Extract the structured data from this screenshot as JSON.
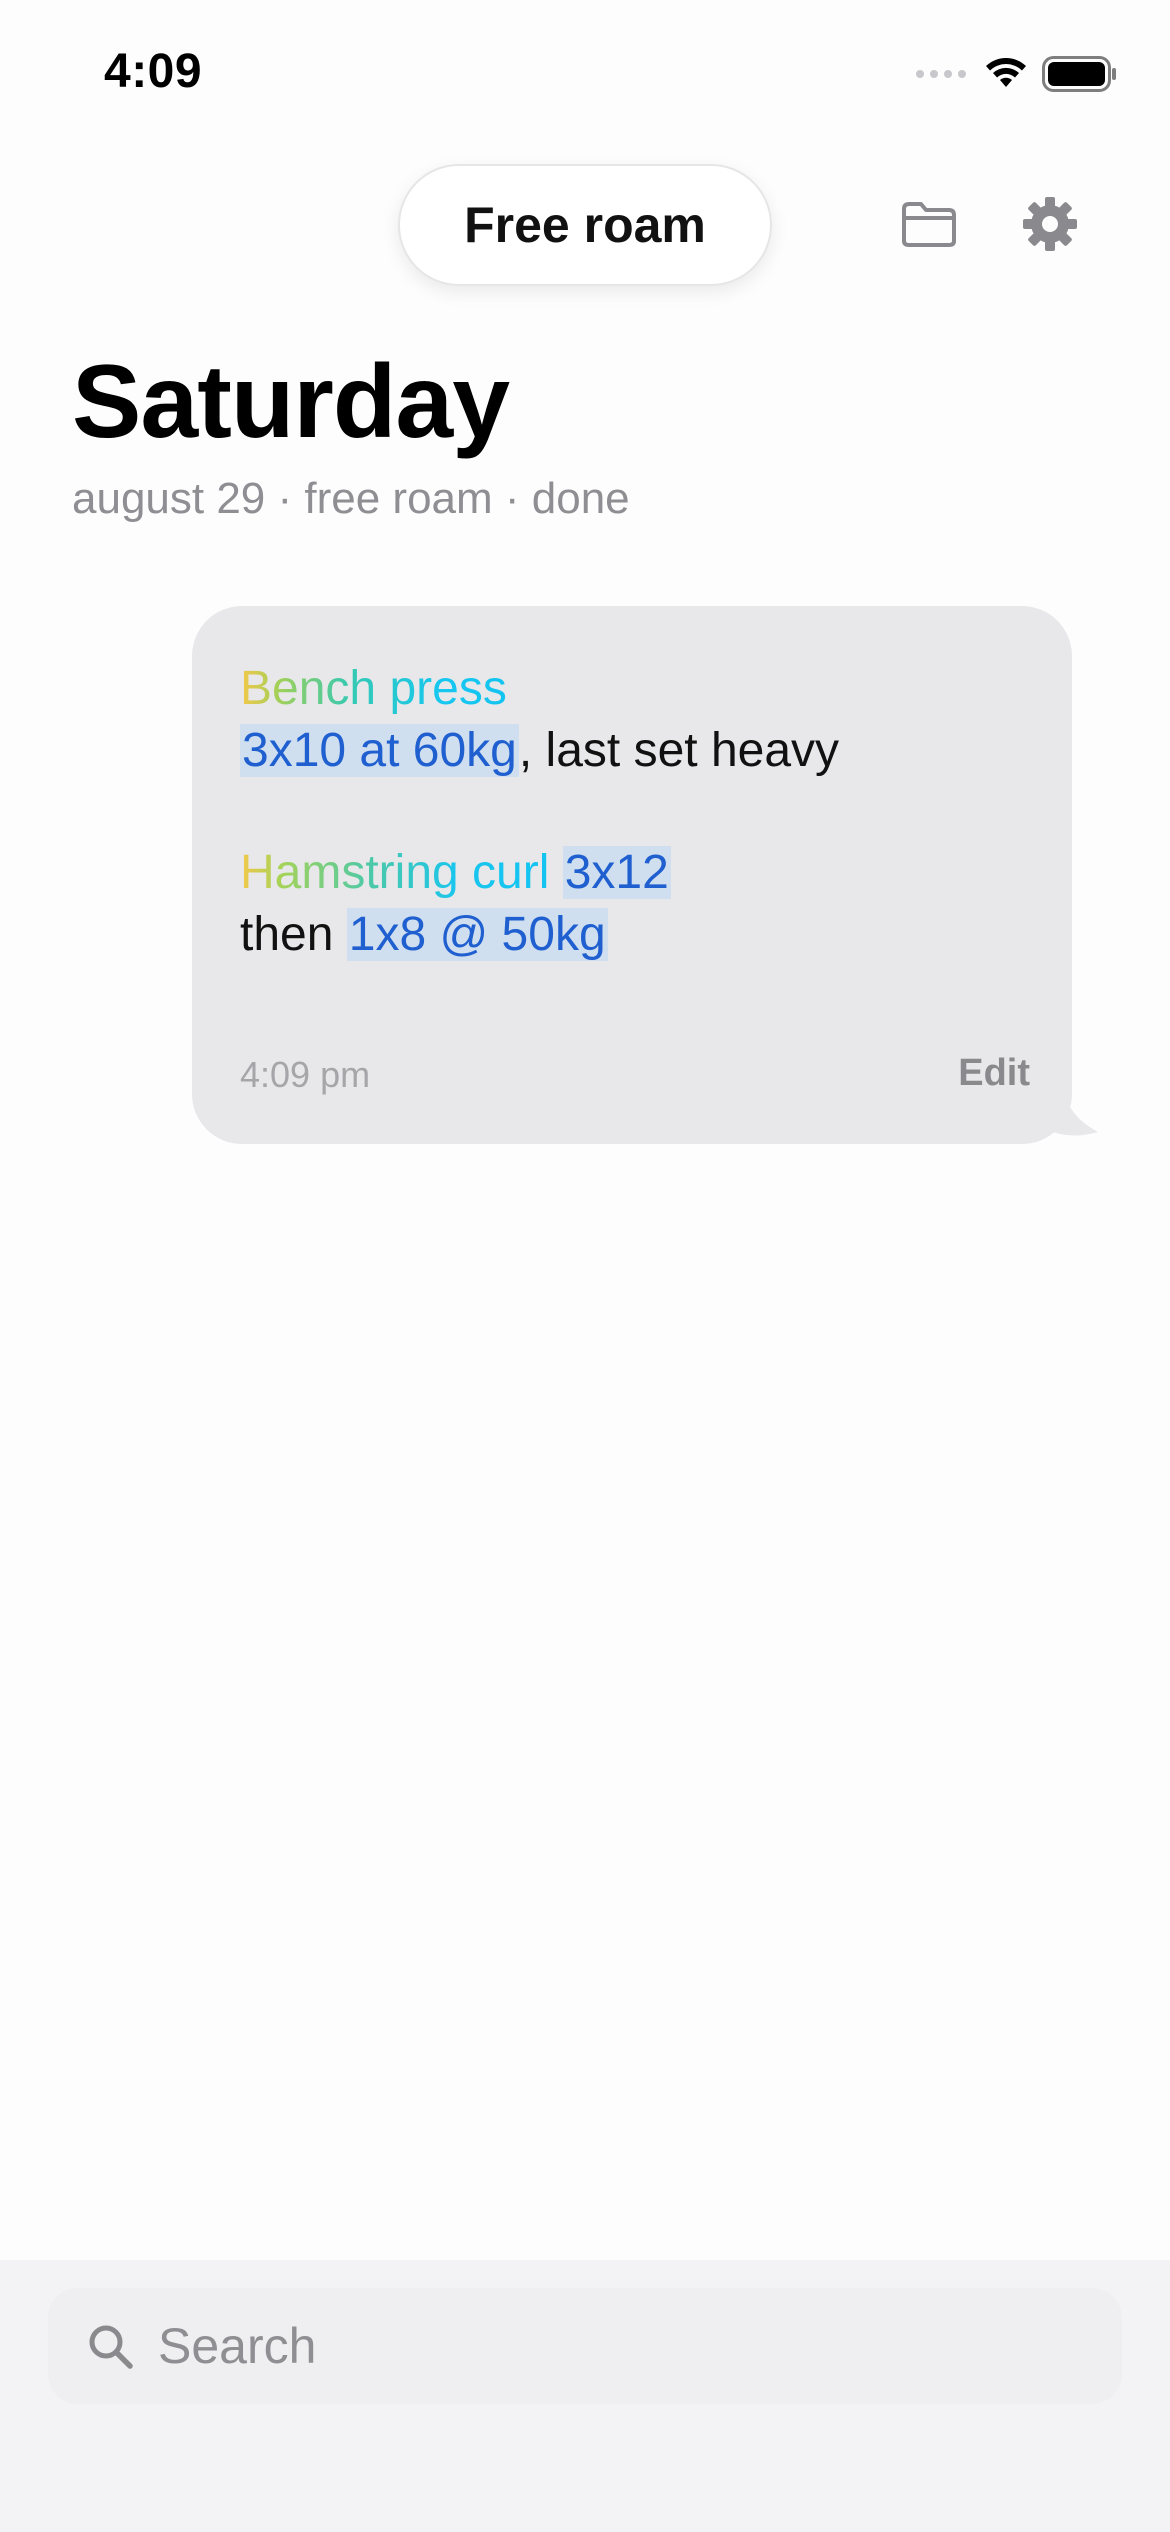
{
  "status_bar": {
    "time": "4:09"
  },
  "top_bar": {
    "mode_label": "Free roam",
    "folder_icon": "folder-icon",
    "settings_icon": "gear-icon"
  },
  "header": {
    "title": "Saturday",
    "subtitle": "august 29 · free roam · done"
  },
  "message": {
    "exercise_1": {
      "name": "Bench press",
      "set_highlight": "3x10 at 60kg",
      "note": ", last set heavy"
    },
    "exercise_2": {
      "name": "Hamstring curl ",
      "set_highlight": "3x12",
      "then_text": "then ",
      "set_highlight_2": "1x8 @ 50kg"
    },
    "timestamp": "4:09 pm",
    "edit_label": "Edit"
  },
  "search": {
    "placeholder": "Search",
    "value": ""
  },
  "colors": {
    "background": "#fdfdfd",
    "bubble": "#e8e8ea",
    "highlight_bg": "#cfdff0",
    "highlight_text": "#1f5fcf",
    "exercise_gradient_start": "#f5c84a",
    "exercise_gradient_end": "#13c4f0",
    "secondary_text": "#8e8e93"
  }
}
